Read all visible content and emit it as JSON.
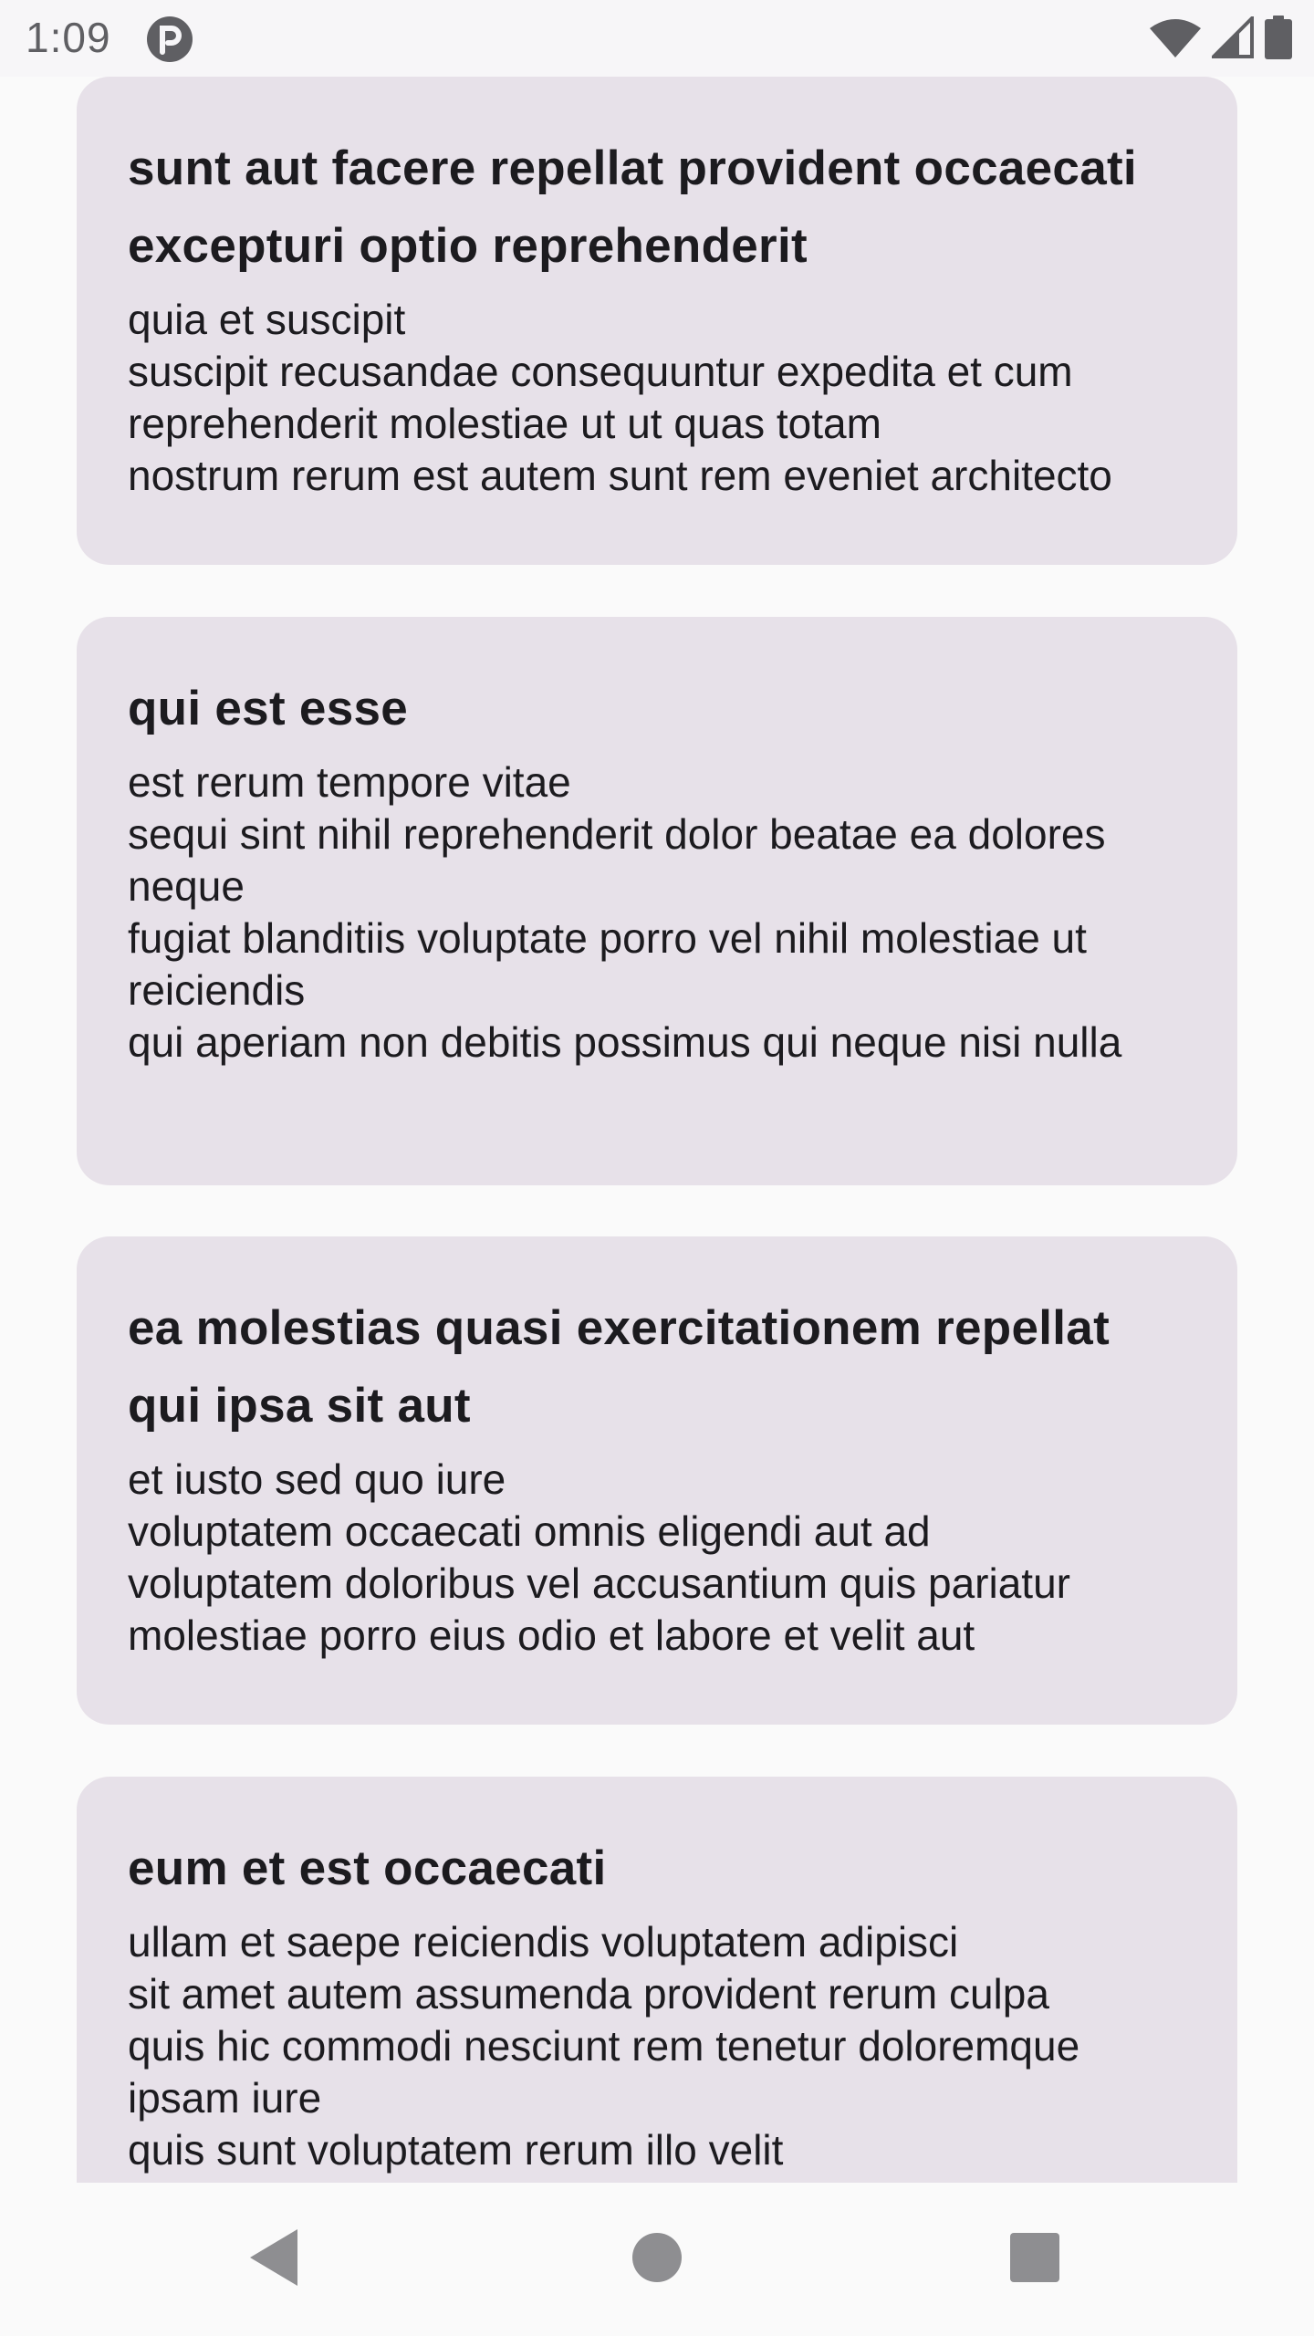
{
  "status_bar": {
    "time": "1:09",
    "icons": [
      "app-notification-icon",
      "wifi-icon",
      "cell-signal-icon",
      "battery-icon"
    ]
  },
  "posts": [
    {
      "title": "sunt aut facere repellat provident occaecati excepturi optio reprehenderit",
      "body": "quia et suscipit\nsuscipit recusandae consequuntur expedita et cum\nreprehenderit molestiae ut ut quas totam\nnostrum rerum est autem sunt rem eveniet architecto"
    },
    {
      "title": "qui est esse",
      "body": "est rerum tempore vitae\nsequi sint nihil reprehenderit dolor beatae ea dolores neque\nfugiat blanditiis voluptate porro vel nihil molestiae ut reiciendis\nqui aperiam non debitis possimus qui neque nisi nulla"
    },
    {
      "title": "ea molestias quasi exercitationem repellat qui ipsa sit aut",
      "body": "et iusto sed quo iure\nvoluptatem occaecati omnis eligendi aut ad\nvoluptatem doloribus vel accusantium quis pariatur\nmolestiae porro eius odio et labore et velit aut"
    },
    {
      "title": "eum et est occaecati",
      "body": "ullam et saepe reiciendis voluptatem adipisci\nsit amet autem assumenda provident rerum culpa\nquis hic commodi nesciunt rem tenetur doloremque ipsam iure\nquis sunt voluptatem rerum illo velit"
    }
  ],
  "nav_bar": {
    "buttons": [
      "back-icon",
      "home-icon",
      "recents-icon"
    ]
  },
  "colors": {
    "card_background": "#e7e1e9",
    "page_background": "#fafafa",
    "text": "#1c1b1f",
    "system_icons": "#5f5f63"
  }
}
